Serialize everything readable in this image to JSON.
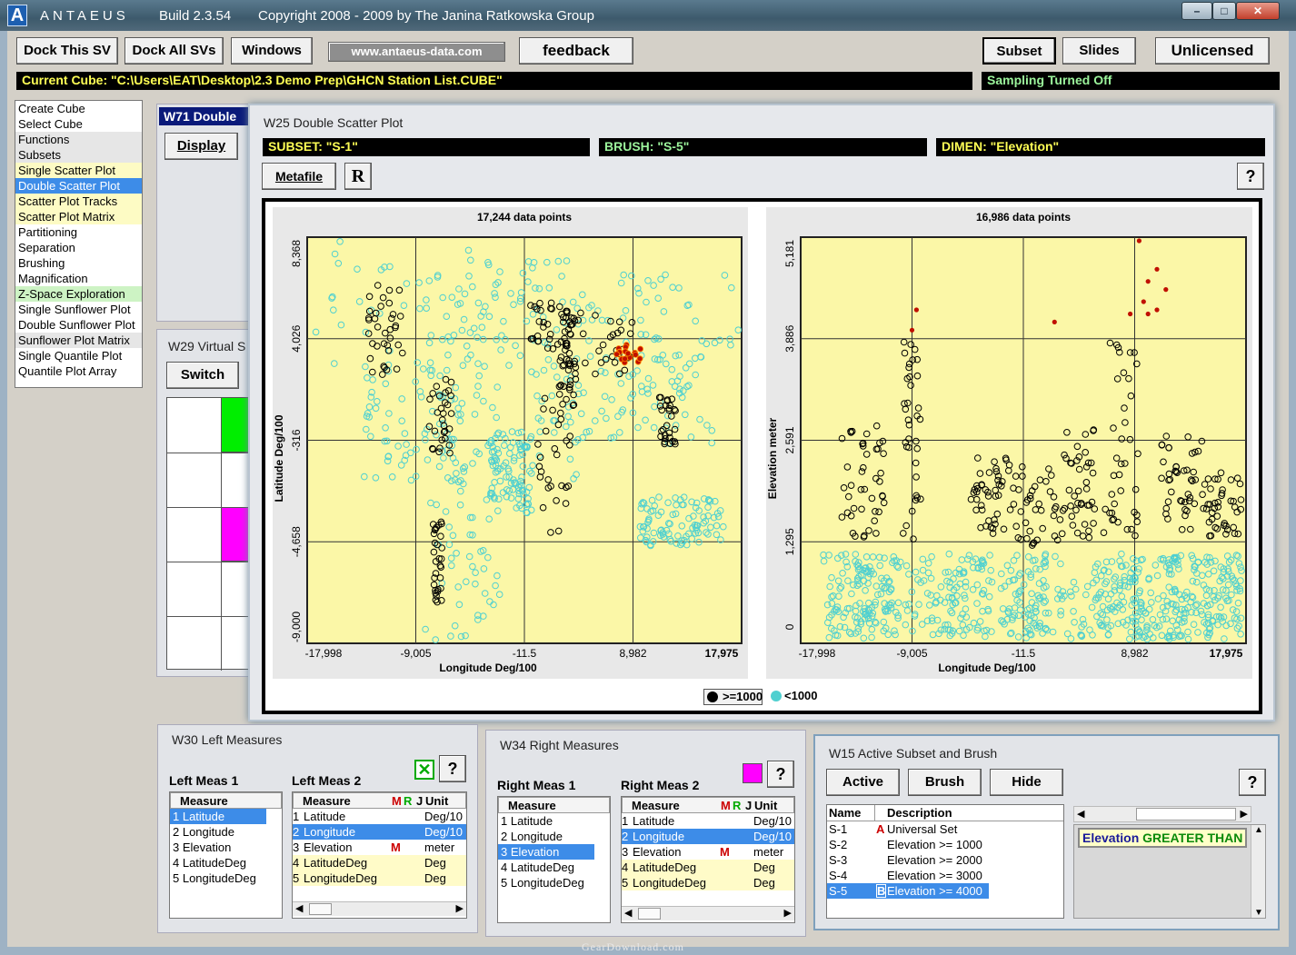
{
  "app": {
    "name": "ANTAEUS",
    "build": "Build 2.3.54",
    "copyright": "Copyright 2008 - 2009 by The Janina Ratkowska Group"
  },
  "toolbar": {
    "dock_this": "Dock This SV",
    "dock_all": "Dock All SVs",
    "windows": "Windows",
    "url": "www.antaeus-data.com",
    "feedback": "feedback",
    "subset": "Subset",
    "slides": "Slides",
    "unlicensed": "Unlicensed"
  },
  "status": {
    "cube": "Current Cube: \"C:\\Users\\EAT\\Desktop\\2.3 Demo Prep\\GHCN Station List.CUBE\"",
    "sampling": "Sampling Turned Off"
  },
  "menu": [
    {
      "label": "Create Cube",
      "bg": "#ffffff"
    },
    {
      "label": "Select Cube",
      "bg": "#ffffff"
    },
    {
      "label": "Functions",
      "bg": "#e6e6e6"
    },
    {
      "label": "Subsets",
      "bg": "#e6e6e6"
    },
    {
      "label": "Single Scatter Plot",
      "bg": "#fdfbc4"
    },
    {
      "label": "Double Scatter Plot",
      "bg": "#3d8ce8",
      "selected": true
    },
    {
      "label": "Scatter Plot Tracks",
      "bg": "#fdfbc4"
    },
    {
      "label": "Scatter Plot Matrix",
      "bg": "#fdfbc4"
    },
    {
      "label": "Partitioning",
      "bg": "#ffffff"
    },
    {
      "label": "Separation",
      "bg": "#ffffff"
    },
    {
      "label": "Brushing",
      "bg": "#ffffff"
    },
    {
      "label": "Magnification",
      "bg": "#ffffff"
    },
    {
      "label": "Z-Space Exploration",
      "bg": "#cdf3c4"
    },
    {
      "label": "Single Sunflower Plot",
      "bg": "#ffffff"
    },
    {
      "label": "Double Sunflower Plot",
      "bg": "#ffffff"
    },
    {
      "label": "Sunflower Plot Matrix",
      "bg": "#e6e6e6"
    },
    {
      "label": "Single Quantile Plot",
      "bg": "#ffffff"
    },
    {
      "label": "Quantile Plot Array",
      "bg": "#ffffff"
    }
  ],
  "w71": {
    "title": "W71  Double",
    "display": "Display"
  },
  "w29": {
    "title": "W29  Virtual S",
    "switch": "Switch"
  },
  "w25": {
    "title": "W25  Double Scatter Plot",
    "subset": "SUBSET: \"S-1\"",
    "brush": "BRUSH: \"S-5\"",
    "dimen": "DIMEN: \"Elevation\"",
    "metafile": "Metafile",
    "r": "R",
    "help": "?"
  },
  "chart_data": [
    {
      "type": "scatter",
      "title": "17,244 data points",
      "xlabel": "Longitude  Deg/100",
      "ylabel": "Latitude  Deg/100",
      "xticks": [
        "-17,998",
        "-9,005",
        "-11.5",
        "8,982",
        "17,975"
      ],
      "yticks": [
        "8,368",
        "4,026",
        "-316",
        "-4,658",
        "-9,000"
      ],
      "series": [
        {
          "name": ">=1000",
          "color": "#000000"
        },
        {
          "name": "<1000",
          "color": "#4fd0d0"
        }
      ]
    },
    {
      "type": "scatter",
      "title": "16,986 data points",
      "xlabel": "Longitude  Deg/100",
      "ylabel": "Elevation  meter",
      "xticks": [
        "-17,998",
        "-9,005",
        "-11.5",
        "8,982",
        "17,975"
      ],
      "yticks": [
        "5,181",
        "3,886",
        "2,591",
        "1,295",
        "0"
      ],
      "series": [
        {
          "name": ">=1000",
          "color": "#000000"
        },
        {
          "name": "<1000",
          "color": "#4fd0d0"
        }
      ]
    }
  ],
  "legend": {
    "hi": ">=1000",
    "lo": "<1000"
  },
  "w30": {
    "title": "W30  Left Measures",
    "lm1": "Left Meas 1",
    "lm2": "Left Meas 2",
    "help": "?",
    "list1": [
      "Latitude",
      "Longitude",
      "Elevation",
      "LatitudeDeg",
      "LongitudeDeg"
    ],
    "hdr": {
      "measure": "Measure",
      "m": "M",
      "r": "R",
      "j": "J",
      "unit": "Unit"
    },
    "list2": [
      {
        "n": "1",
        "name": "Latitude",
        "m": "",
        "unit": "Deg/10"
      },
      {
        "n": "2",
        "name": "Longitude",
        "m": "",
        "unit": "Deg/10"
      },
      {
        "n": "3",
        "name": "Elevation",
        "m": "M",
        "unit": "meter"
      },
      {
        "n": "4",
        "name": "LatitudeDeg",
        "m": "",
        "unit": "Deg"
      },
      {
        "n": "5",
        "name": "LongitudeDeg",
        "m": "",
        "unit": "Deg"
      }
    ]
  },
  "w34": {
    "title": "W34  Right Measures",
    "rm1": "Right Meas 1",
    "rm2": "Right Meas 2",
    "help": "?",
    "list1": [
      "Latitude",
      "Longitude",
      "Elevation",
      "LatitudeDeg",
      "LongitudeDeg"
    ],
    "list2": [
      {
        "n": "1",
        "name": "Latitude",
        "m": "",
        "unit": "Deg/10"
      },
      {
        "n": "2",
        "name": "Longitude",
        "m": "",
        "unit": "Deg/10"
      },
      {
        "n": "3",
        "name": "Elevation",
        "m": "M",
        "unit": "meter"
      },
      {
        "n": "4",
        "name": "LatitudeDeg",
        "m": "",
        "unit": "Deg"
      },
      {
        "n": "5",
        "name": "LongitudeDeg",
        "m": "",
        "unit": "Deg"
      }
    ]
  },
  "w15": {
    "title": "W15  Active Subset and Brush",
    "active": "Active",
    "brush": "Brush",
    "hide": "Hide",
    "help": "?",
    "hdr_name": "Name",
    "hdr_desc": "Description",
    "rows": [
      {
        "name": "S-1",
        "flag": "A",
        "desc": "Universal Set"
      },
      {
        "name": "S-2",
        "flag": "",
        "desc": "Elevation >= 1000"
      },
      {
        "name": "S-3",
        "flag": "",
        "desc": "Elevation >= 2000"
      },
      {
        "name": "S-4",
        "flag": "",
        "desc": "Elevation >= 3000"
      },
      {
        "name": "S-5",
        "flag": "B",
        "desc": "Elevation >= 4000"
      }
    ],
    "expr_a": "Elevation",
    "expr_b": "GREATER THAN"
  },
  "watermark": "GearDownload.com"
}
